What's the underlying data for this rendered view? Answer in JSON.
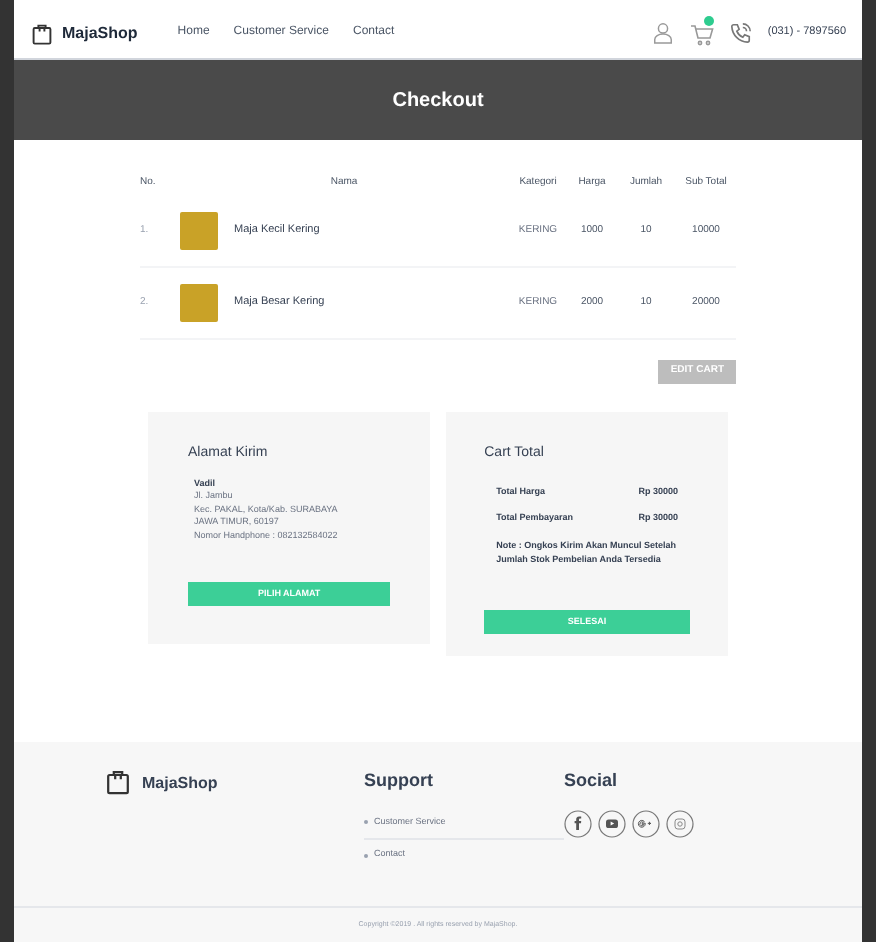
{
  "navbar": {
    "brand": "MajaShop",
    "links": [
      "Home",
      "Customer Service",
      "Contact"
    ],
    "phone": "(031) - 7897560"
  },
  "header": {
    "title": "Checkout"
  },
  "table": {
    "columns": [
      "No.",
      "Nama",
      "Kategori",
      "Harga",
      "Jumlah",
      "Sub Total"
    ],
    "rows": [
      {
        "no": "1.",
        "name": "Maja Kecil Kering",
        "category": "KERING",
        "price": "1000",
        "qty": "10",
        "subtotal": "10000"
      },
      {
        "no": "2.",
        "name": "Maja Besar Kering",
        "category": "KERING",
        "price": "2000",
        "qty": "10",
        "subtotal": "20000"
      }
    ],
    "edit_button": "EDIT CART"
  },
  "address": {
    "title": "Alamat Kirim",
    "name": "Vadil",
    "lines": [
      "Jl. Jambu",
      "Kec. PAKAL, Kota/Kab. SURABAYA",
      "JAWA TIMUR, 60197",
      "Nomor Handphone : 082132584022"
    ],
    "button": "PILIH ALAMAT"
  },
  "cart_total": {
    "title": "Cart Total",
    "rows": [
      {
        "label": "Total Harga",
        "value": "Rp 30000"
      },
      {
        "label": "Total Pembayaran",
        "value": "Rp 30000"
      }
    ],
    "note": "Note : Ongkos Kirim Akan Muncul Setelah Jumlah Stok Pembelian Anda Tersedia",
    "button": "SELESAI"
  },
  "footer": {
    "brand": "MajaShop",
    "support_title": "Support",
    "support_links": [
      "Customer Service",
      "Contact"
    ],
    "social_title": "Social",
    "copyright": "Copyright ©2019 . All rights reserved by MajaShop."
  }
}
